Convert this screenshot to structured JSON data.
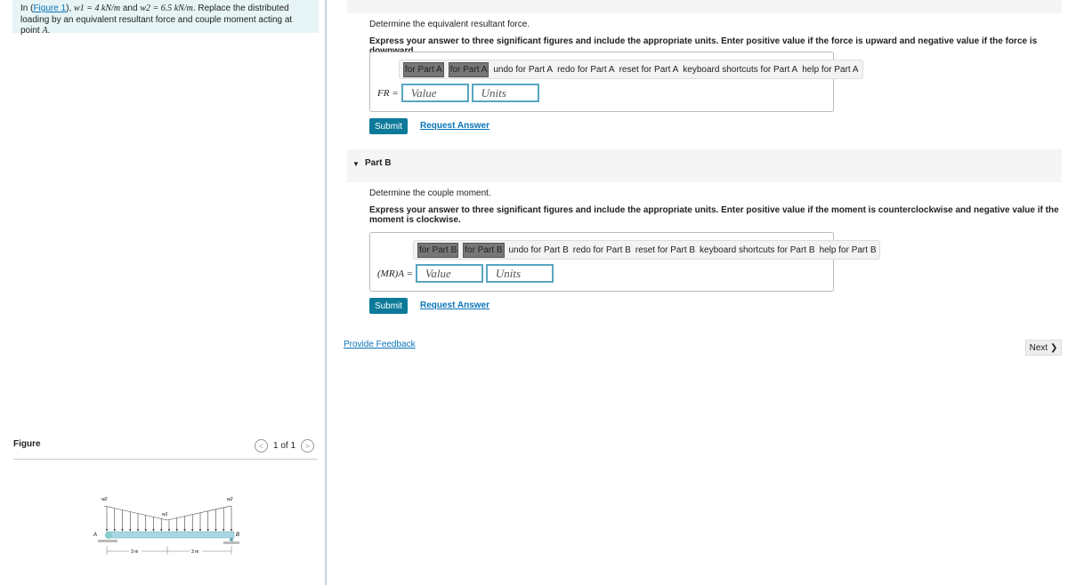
{
  "problem": {
    "prefix": "In (",
    "link": "Figure 1",
    "text1": "), ",
    "w1": "w1 = 4 kN/m",
    "and": " and ",
    "w2": "w2 = 6.5 kN/m",
    "text2": ". Replace the distributed loading by an equivalent resultant force and couple moment acting at point ",
    "point": "A",
    "end": "."
  },
  "figure": {
    "label": "Figure",
    "pager": "1 of 1",
    "prev_icon": "chevron-left",
    "next_icon": "chevron-right",
    "labels": {
      "w2_left": "w2",
      "w1_mid": "w1",
      "w2_right": "w2",
      "A": "A",
      "B": "B",
      "dim1": "3 m",
      "dim2": "3 m"
    }
  },
  "partA": {
    "question": "Determine the equivalent resultant force.",
    "instructions": "Express your answer to three significant figures and include the appropriate units. Enter positive value if the force is upward and negative value if the force is downward.",
    "toolbar": [
      "for Part A",
      "for Part A",
      "undo for Part A",
      "redo for Part A",
      "reset for Part A",
      "keyboard shortcuts for Part A",
      "help for Part A"
    ],
    "label": "FR =",
    "value_placeholder": "Value",
    "units_placeholder": "Units",
    "submit": "Submit",
    "request": "Request Answer"
  },
  "partB": {
    "title": "Part B",
    "question": "Determine the couple moment.",
    "instructions": "Express your answer to three significant figures and include the appropriate units. Enter positive value if the moment is counterclockwise and negative value if the moment is clockwise.",
    "toolbar": [
      "for Part B",
      "for Part B",
      "undo for Part B",
      "redo for Part B",
      "reset for Part B",
      "keyboard shortcuts for Part B",
      "help for Part B"
    ],
    "label": "(MR)A =",
    "value_placeholder": "Value",
    "units_placeholder": "Units",
    "submit": "Submit",
    "request": "Request Answer"
  },
  "footer": {
    "feedback": "Provide Feedback",
    "next": "Next"
  }
}
